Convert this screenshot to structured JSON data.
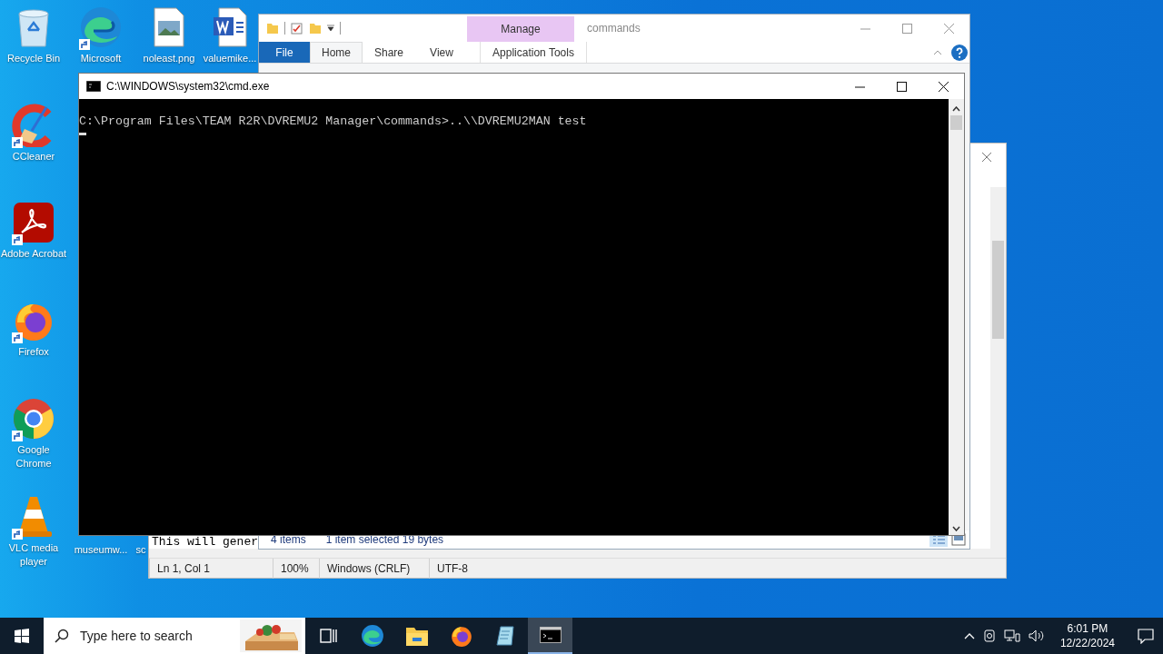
{
  "desktop_icons": [
    {
      "label": "Recycle Bin",
      "kind": "recycle-bin",
      "shortcut": false
    },
    {
      "label": "Microsoft",
      "kind": "edge",
      "shortcut": true
    },
    {
      "label": "noleast.png",
      "kind": "image-file",
      "shortcut": false
    },
    {
      "label": "valuemike...",
      "kind": "word-file",
      "shortcut": false
    },
    {
      "label": "CCleaner",
      "kind": "ccleaner",
      "shortcut": true
    },
    {
      "label": "Adobe Acrobat",
      "kind": "acrobat",
      "shortcut": true
    },
    {
      "label": "Firefox",
      "kind": "firefox",
      "shortcut": true
    },
    {
      "label": "Google Chrome",
      "kind": "chrome",
      "shortcut": true
    },
    {
      "label": "VLC media player",
      "kind": "vlc",
      "shortcut": true
    },
    {
      "label": "museumw...",
      "kind": "covered",
      "shortcut": false
    },
    {
      "label": "sc",
      "kind": "covered",
      "shortcut": false
    }
  ],
  "notepad": {
    "text_line": "This will gener",
    "status": [
      "Ln 1, Col 1",
      "100%",
      "Windows (CRLF)",
      "UTF-8"
    ]
  },
  "explorer": {
    "title": "commands",
    "context_header": "Manage",
    "tabs": [
      {
        "label": "File",
        "kind": "file",
        "selected": false
      },
      {
        "label": "Home",
        "kind": "tab",
        "selected": true
      },
      {
        "label": "Share",
        "kind": "tab",
        "selected": false
      },
      {
        "label": "View",
        "kind": "tab",
        "selected": false
      },
      {
        "label": "Application Tools",
        "kind": "context",
        "selected": false
      }
    ],
    "status_items": "4 items",
    "status_selection": "1 item selected  19 bytes"
  },
  "cmd": {
    "title": "C:\\WINDOWS\\system32\\cmd.exe",
    "lines": [
      "C:\\Program Files\\TEAM R2R\\DVREMU2 Manager\\commands>..\\\\DVREMU2MAN test"
    ],
    "cursor": true
  },
  "taskbar": {
    "search_placeholder": "Type here to search",
    "apps": [
      {
        "kind": "task-view",
        "selected": false
      },
      {
        "kind": "edge",
        "selected": false
      },
      {
        "kind": "explorer",
        "selected": false
      },
      {
        "kind": "firefox",
        "selected": false
      },
      {
        "kind": "notepad",
        "selected": false
      },
      {
        "kind": "cmd",
        "selected": true
      }
    ],
    "time": "6:01 PM",
    "date": "12/22/2024"
  }
}
